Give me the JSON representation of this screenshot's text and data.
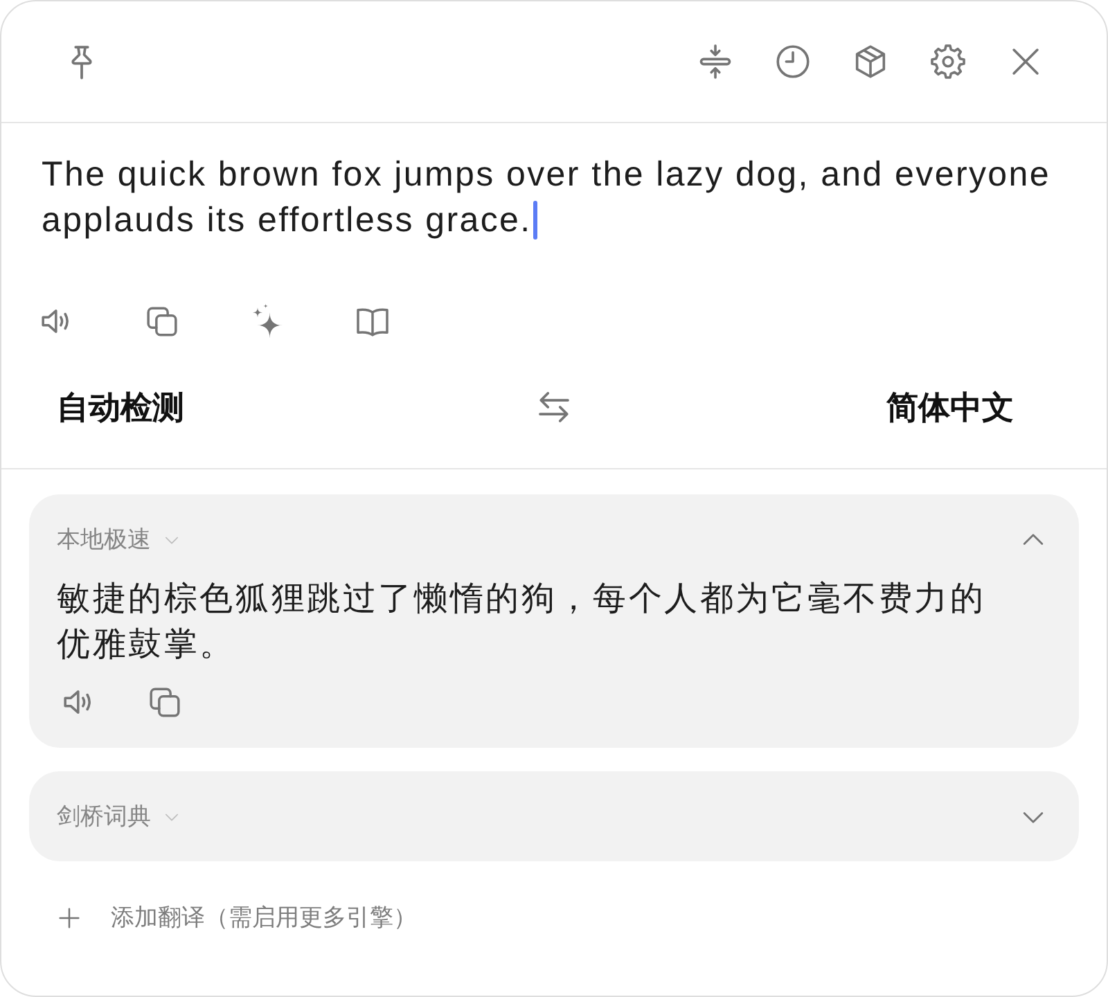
{
  "source": {
    "value": "The quick brown fox jumps over the lazy dog, and everyone applauds its effortless grace.",
    "focused": true
  },
  "languages": {
    "source": "自动检测",
    "target": "简体中文"
  },
  "results": [
    {
      "engine": "本地极速",
      "expanded": true,
      "text": "敏捷的棕色狐狸跳过了懒惰的狗，每个人都为它毫不费力的优雅鼓掌。"
    },
    {
      "engine": "剑桥词典",
      "expanded": false
    }
  ],
  "add_translation": {
    "label": "添加翻译（需启用更多引擎）"
  }
}
